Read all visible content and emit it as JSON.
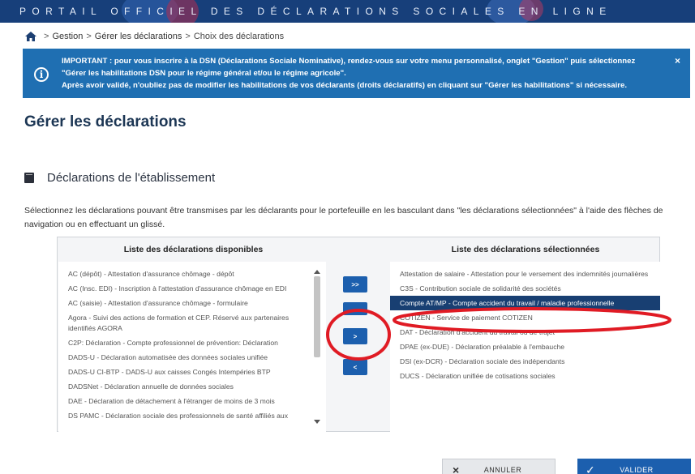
{
  "header": {
    "title": "PORTAIL OFFICIEL DES DÉCLARATIONS SOCIALES EN LIGNE",
    "colors": {
      "bar": "#173f7a"
    }
  },
  "breadcrumb": {
    "home_icon": "home-icon",
    "items": [
      "Gestion",
      "Gérer les déclarations",
      "Choix des déclarations"
    ]
  },
  "alert": {
    "icon": "info-icon",
    "lines": [
      "IMPORTANT : pour vous inscrire à la DSN (Déclarations Sociale Nominative), rendez-vous sur votre menu personnalisé, onglet \"Gestion\" puis sélectionnez",
      "\"Gérer les habilitations DSN pour le régime général et/ou le régime agricole\".",
      "Après avoir validé, n'oubliez pas de modifier les habilitations de vos déclarants (droits déclaratifs) en cliquant sur \"Gérer les habilitations\" si nécessaire."
    ],
    "close": "×",
    "color": "#1f6fb2"
  },
  "page_title": "Gérer les déclarations",
  "section": {
    "icon": "book-icon",
    "title": "Déclarations de l'établissement"
  },
  "intro": "Sélectionnez les déclarations pouvant être transmises par les déclarants pour le portefeuille en les basculant dans \"les déclarations sélectionnées\" à l'aide des flèches de navigation ou en effectuant un glissé.",
  "available": {
    "header": "Liste des déclarations disponibles",
    "items": [
      "AC (dépôt) - Attestation d'assurance chômage - dépôt",
      "AC (Insc. EDI) - Inscription à l'attestation d'assurance chômage en EDI",
      "AC (saisie) - Attestation d'assurance chômage - formulaire",
      "Agora - Suivi des actions de formation et CEP. Réservé aux partenaires identifiés AGORA",
      "C2P: Déclaration - Compte professionnel de prévention: Déclaration",
      "DADS-U - Déclaration automatisée des données sociales unifiée",
      "DADS-U CI-BTP - DADS-U aux caisses Congés Intempéries BTP",
      "DADSNet - Déclaration annuelle de données sociales",
      "DAE - Déclaration de détachement à l'étranger de moins de 3 mois",
      "DS PAMC - Déclaration sociale des professionnels de santé affiliés aux"
    ]
  },
  "selected": {
    "header": "Liste des déclarations sélectionnées",
    "items": [
      "Attestation de salaire - Attestation pour le versement des indemnités journalières",
      "C3S - Contribution sociale de solidarité des sociétés",
      "Compte AT/MP - Compte accident du travail / maladie professionnelle",
      "COTIZEN - Service de paiement COTIZEN",
      "DAT - Déclaration d'accident du travail ou de trajet",
      "DPAE (ex-DUE) - Déclaration préalable à l'embauche",
      "DSI (ex-DCR) - Déclaration sociale des indépendants",
      "DUCS - Déclaration unifiée de cotisations sociales"
    ],
    "highlighted_index": 2
  },
  "movers": {
    "all_right": ">>",
    "one_right": ">",
    "one_left": "<"
  },
  "buttons": {
    "cancel": "ANNULER",
    "validate": "VALIDER",
    "cancel_icon": "×",
    "validate_icon": "✓"
  },
  "annotation_color": "#e01b24"
}
